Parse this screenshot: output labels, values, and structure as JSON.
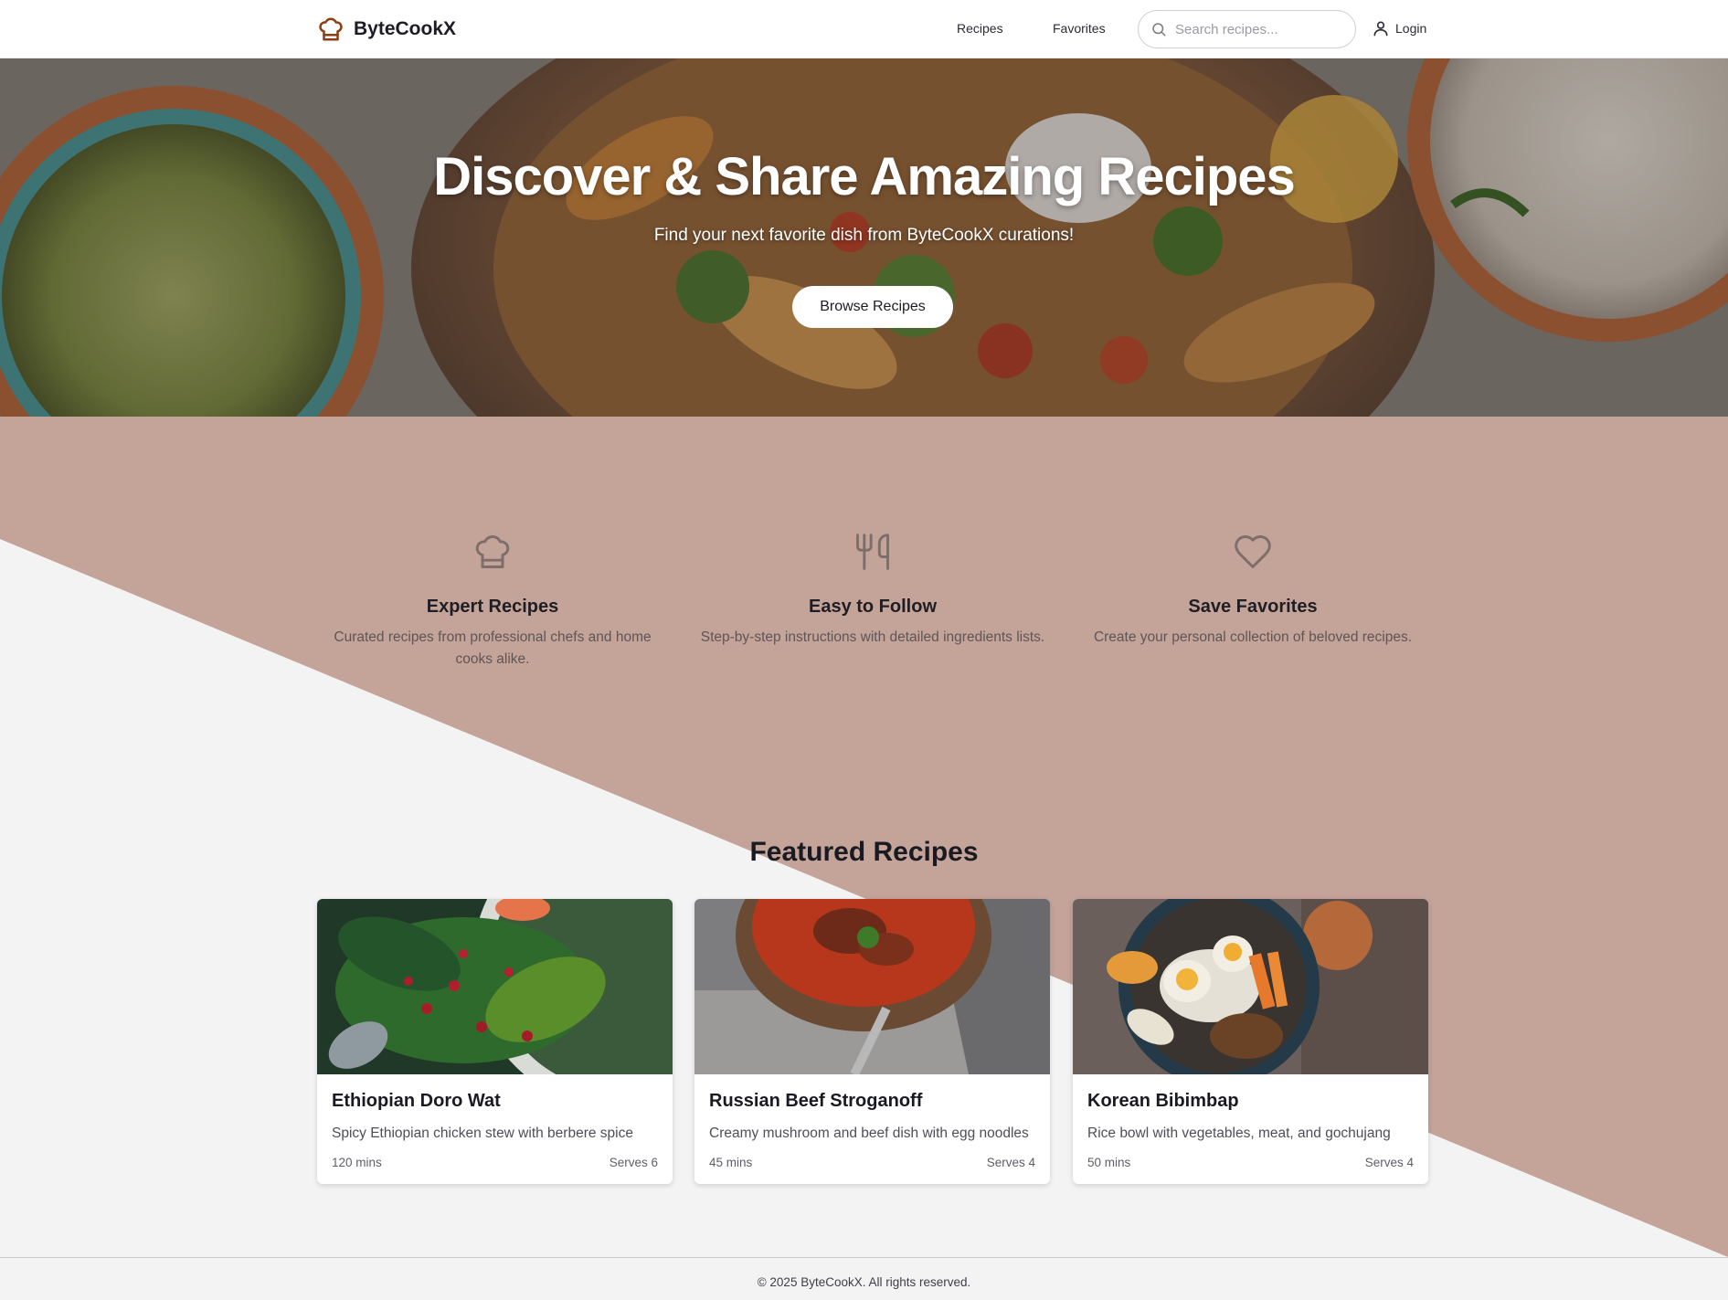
{
  "brand": {
    "name": "ByteCookX",
    "icon": "chef-hat-icon"
  },
  "nav": {
    "links": [
      {
        "label": "Recipes"
      },
      {
        "label": "Favorites"
      }
    ],
    "search": {
      "placeholder": "Search recipes...",
      "value": "",
      "icon": "search-icon"
    },
    "login": {
      "label": "Login",
      "icon": "user-icon"
    }
  },
  "hero": {
    "title": "Discover & Share Amazing Recipes",
    "subtitle": "Find your next favorite dish from ByteCookX curations!",
    "button_label": "Browse Recipes"
  },
  "features": [
    {
      "icon": "chef-hat-icon",
      "title": "Expert Recipes",
      "description": "Curated recipes from professional chefs and home cooks alike."
    },
    {
      "icon": "utensils-icon",
      "title": "Easy to Follow",
      "description": "Step-by-step instructions with detailed ingredients lists."
    },
    {
      "icon": "heart-icon",
      "title": "Save Favorites",
      "description": "Create your personal collection of beloved recipes."
    }
  ],
  "featured": {
    "title": "Featured Recipes",
    "recipes": [
      {
        "title": "Ethiopian Doro Wat",
        "description": "Spicy Ethiopian chicken stew with berbere spice",
        "time": "120 mins",
        "serves": "Serves 6"
      },
      {
        "title": "Russian Beef Stroganoff",
        "description": "Creamy mushroom and beef dish with egg noodles",
        "time": "45 mins",
        "serves": "Serves 4"
      },
      {
        "title": "Korean Bibimbap",
        "description": "Rice bowl with vegetables, meat, and gochujang",
        "time": "50 mins",
        "serves": "Serves 4"
      }
    ]
  },
  "footer": {
    "text": "© 2025 ByteCookX. All rights reserved."
  },
  "colors": {
    "accent_band": "#c4a399",
    "brand_icon": "#8b3f12",
    "feature_icon": "#7d6e6b",
    "page_bg": "#f3f3f4"
  }
}
